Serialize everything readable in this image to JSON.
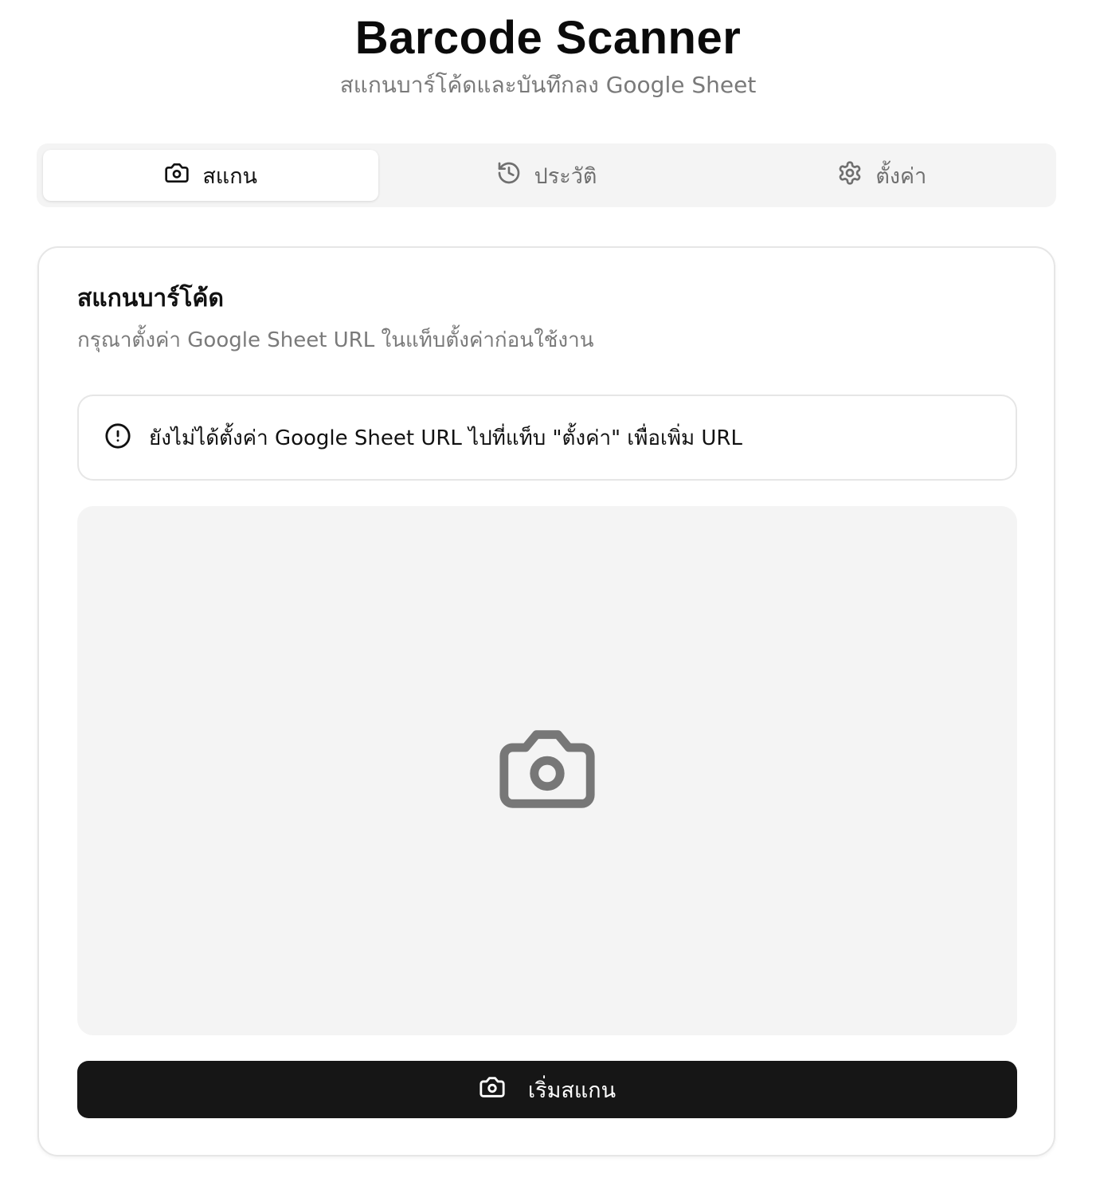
{
  "header": {
    "title": "Barcode Scanner",
    "subtitle": "สแกนบาร์โค้ดและบันทึกลง Google Sheet"
  },
  "tabs": [
    {
      "label": "สแกน",
      "icon": "camera-icon",
      "active": true
    },
    {
      "label": "ประวัติ",
      "icon": "history-icon",
      "active": false
    },
    {
      "label": "ตั้งค่า",
      "icon": "gear-icon",
      "active": false
    }
  ],
  "scan_card": {
    "title": "สแกนบาร์โค้ด",
    "description": "กรุณาตั้งค่า Google Sheet URL ในแท็บตั้งค่าก่อนใช้งาน",
    "alert": {
      "icon": "alert-circle-icon",
      "text": "ยังไม่ได้ตั้งค่า Google Sheet URL ไปที่แท็บ \"ตั้งค่า\" เพื่อเพิ่ม URL"
    },
    "preview_icon": "camera-icon",
    "start_button": {
      "label": "เริ่มสแกน",
      "icon": "camera-icon"
    }
  },
  "colors": {
    "primary_button": "#161616",
    "muted_text": "#7a7a7a",
    "tab_bar_bg": "#f4f4f4",
    "preview_bg": "#f4f4f4",
    "border": "#e6e6e6"
  }
}
